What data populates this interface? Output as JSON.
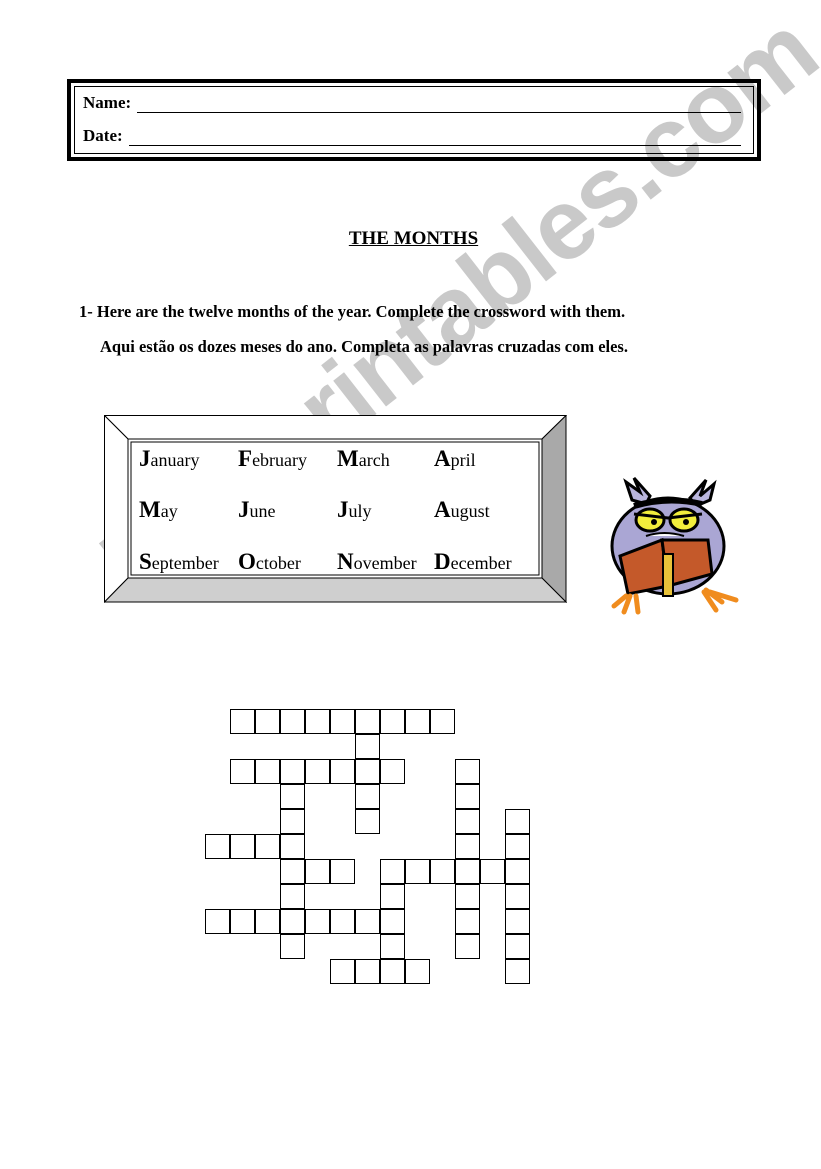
{
  "header": {
    "name_label": "Name:",
    "date_label": "Date:"
  },
  "title": "THE MONTHS",
  "exercise": {
    "instruction_en": "1- Here are the twelve months of the year. Complete the crossword with them.",
    "instruction_pt": "Aqui estão os dozes meses do ano. Completa as palavras cruzadas com eles."
  },
  "months": [
    {
      "cap": "J",
      "rest": "anuary"
    },
    {
      "cap": "F",
      "rest": "ebruary"
    },
    {
      "cap": "M",
      "rest": "arch"
    },
    {
      "cap": "A",
      "rest": "pril"
    },
    {
      "cap": "M",
      "rest": "ay"
    },
    {
      "cap": "J",
      "rest": "une"
    },
    {
      "cap": "J",
      "rest": "uly"
    },
    {
      "cap": "A",
      "rest": "ugust"
    },
    {
      "cap": "S",
      "rest": "eptember"
    },
    {
      "cap": "O",
      "rest": "ctober"
    },
    {
      "cap": "N",
      "rest": "ovember"
    },
    {
      "cap": "D",
      "rest": "ecember"
    }
  ],
  "crossword": {
    "cells": [
      [
        0,
        1
      ],
      [
        0,
        2
      ],
      [
        0,
        3
      ],
      [
        0,
        4
      ],
      [
        0,
        5
      ],
      [
        0,
        6
      ],
      [
        0,
        7
      ],
      [
        0,
        8
      ],
      [
        0,
        9
      ],
      [
        1,
        6
      ],
      [
        2,
        1
      ],
      [
        2,
        2
      ],
      [
        2,
        3
      ],
      [
        2,
        4
      ],
      [
        2,
        5
      ],
      [
        2,
        6
      ],
      [
        2,
        7
      ],
      [
        2,
        10
      ],
      [
        3,
        3
      ],
      [
        3,
        6
      ],
      [
        3,
        10
      ],
      [
        4,
        3
      ],
      [
        4,
        6
      ],
      [
        4,
        10
      ],
      [
        4,
        12
      ],
      [
        5,
        0
      ],
      [
        5,
        1
      ],
      [
        5,
        2
      ],
      [
        5,
        3
      ],
      [
        5,
        10
      ],
      [
        5,
        12
      ],
      [
        6,
        3
      ],
      [
        6,
        4
      ],
      [
        6,
        5
      ],
      [
        6,
        7
      ],
      [
        6,
        8
      ],
      [
        6,
        9
      ],
      [
        6,
        10
      ],
      [
        6,
        11
      ],
      [
        6,
        12
      ],
      [
        7,
        3
      ],
      [
        7,
        7
      ],
      [
        7,
        10
      ],
      [
        7,
        12
      ],
      [
        8,
        0
      ],
      [
        8,
        1
      ],
      [
        8,
        2
      ],
      [
        8,
        3
      ],
      [
        8,
        4
      ],
      [
        8,
        5
      ],
      [
        8,
        6
      ],
      [
        8,
        7
      ],
      [
        8,
        10
      ],
      [
        8,
        12
      ],
      [
        9,
        3
      ],
      [
        9,
        7
      ],
      [
        9,
        10
      ],
      [
        9,
        12
      ],
      [
        10,
        5
      ],
      [
        10,
        6
      ],
      [
        10,
        7
      ],
      [
        10,
        8
      ],
      [
        10,
        12
      ]
    ]
  },
  "watermark": "ESLprintables.com",
  "illustration": "owl-reading-book"
}
